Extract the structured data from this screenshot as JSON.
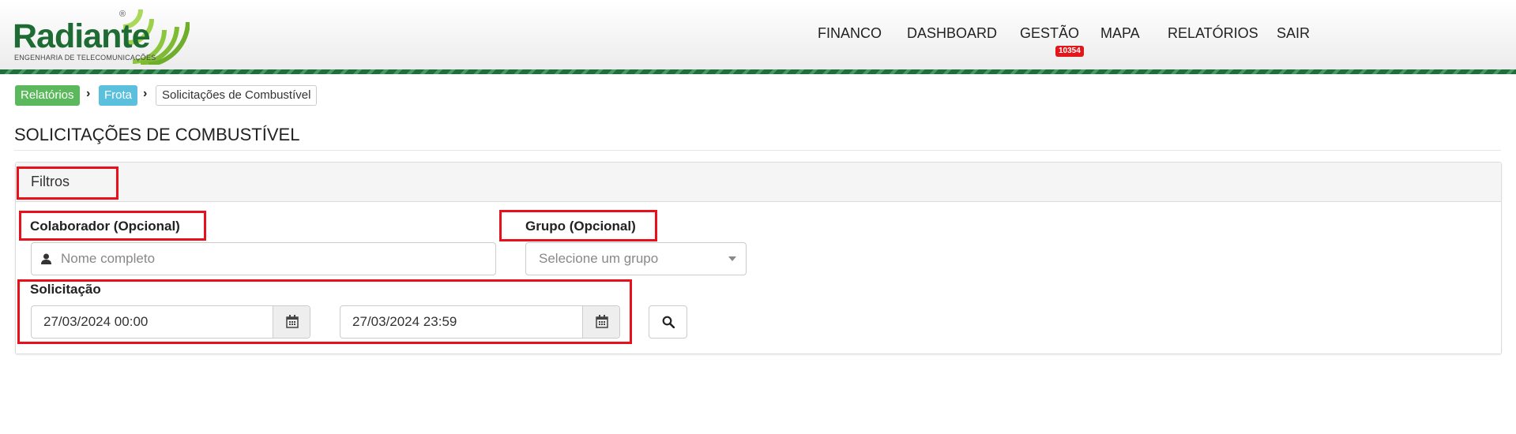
{
  "brand": {
    "name": "Radiante",
    "tagline": "ENGENHARIA DE TELECOMUNICAÇÕES",
    "registered": "®",
    "color": "#1e6b34"
  },
  "nav": {
    "items": [
      {
        "label": "FINANCO"
      },
      {
        "label": "DASHBOARD"
      },
      {
        "label": "GESTÃO",
        "badge": "10354"
      },
      {
        "label": "MAPA"
      },
      {
        "label": "RELATÓRIOS"
      },
      {
        "label": "SAIR"
      }
    ]
  },
  "breadcrumb": {
    "items": [
      {
        "label": "Relatórios",
        "color": "#5cb85c"
      },
      {
        "label": "Frota",
        "color": "#5bc0de"
      },
      {
        "label": "Solicitações de Combustível"
      }
    ]
  },
  "page": {
    "title": "SOLICITAÇÕES DE COMBUSTÍVEL"
  },
  "filters": {
    "title": "Filtros",
    "colaborador": {
      "label": "Colaborador (Opcional)",
      "placeholder": "Nome completo",
      "icon": "user-icon"
    },
    "grupo": {
      "label": "Grupo (Opcional)",
      "placeholder": "Selecione um grupo"
    },
    "solicitacao": {
      "label": "Solicitação",
      "start": "27/03/2024 00:00",
      "end": "27/03/2024 23:59",
      "icon": "calendar-icon"
    },
    "search_icon": "search-icon"
  },
  "highlight_color": "#e8101a"
}
